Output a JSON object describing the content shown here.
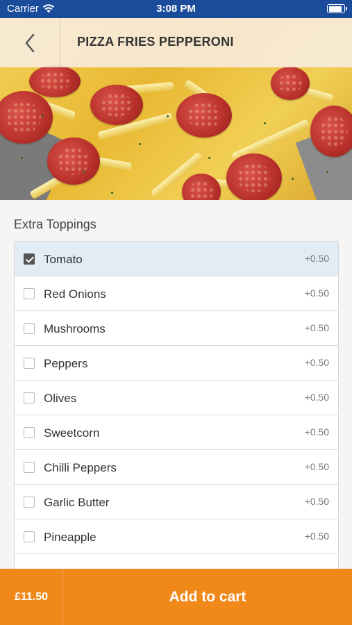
{
  "status_bar": {
    "carrier": "Carrier",
    "time": "3:08 PM",
    "battery_level": 0.9
  },
  "header": {
    "back_icon": "chevron-left-icon",
    "title": "PIZZA FRIES PEPPERONI"
  },
  "section": {
    "title": "Extra Toppings"
  },
  "toppings": [
    {
      "name": "Tomato",
      "price": "+0.50",
      "checked": true
    },
    {
      "name": "Red Onions",
      "price": "+0.50",
      "checked": false
    },
    {
      "name": "Mushrooms",
      "price": "+0.50",
      "checked": false
    },
    {
      "name": "Peppers",
      "price": "+0.50",
      "checked": false
    },
    {
      "name": "Olives",
      "price": "+0.50",
      "checked": false
    },
    {
      "name": "Sweetcorn",
      "price": "+0.50",
      "checked": false
    },
    {
      "name": "Chilli Peppers",
      "price": "+0.50",
      "checked": false
    },
    {
      "name": "Garlic Butter",
      "price": "+0.50",
      "checked": false
    },
    {
      "name": "Pineapple",
      "price": "+0.50",
      "checked": false
    }
  ],
  "cart": {
    "price": "£11.50",
    "button_label": "Add to cart"
  },
  "colors": {
    "status_bar": "#1b4c9c",
    "accent": "#f0891a",
    "selected_row": "#e1ecf4"
  }
}
